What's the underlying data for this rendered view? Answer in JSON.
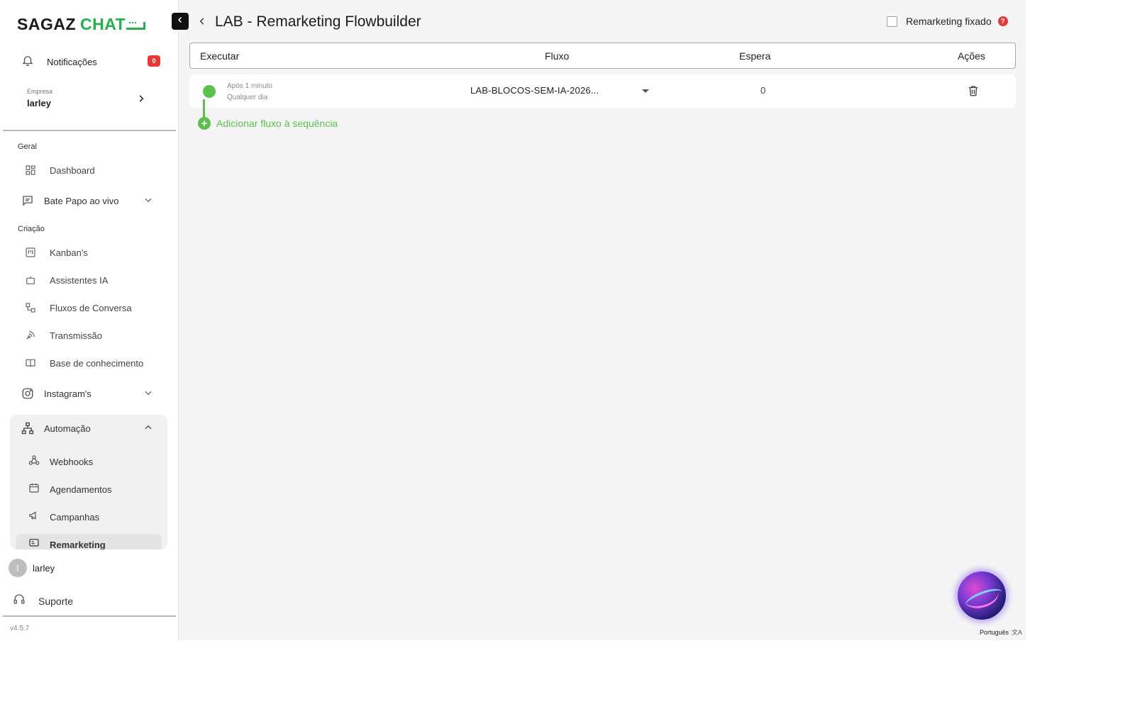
{
  "sidebar": {
    "logo": {
      "part1": "SAGAZ",
      "part2": "CHAT"
    },
    "notifications": {
      "label": "Notificações",
      "count": "0"
    },
    "company": {
      "caption": "Empresa",
      "name": "larley"
    },
    "sections": {
      "geral": "Geral",
      "criacao": "Criação"
    },
    "items": {
      "dashboard": "Dashboard",
      "bate_papo": "Bate Papo ao vivo",
      "kanban": "Kanban's",
      "assistentes": "Assistentes IA",
      "fluxos": "Fluxos de Conversa",
      "transmissao": "Transmissão",
      "base": "Base de conhecimento",
      "instagram": "Instagram's",
      "automacao": "Automação",
      "webhooks": "Webhooks",
      "agendamentos": "Agendamentos",
      "campanhas": "Campanhas",
      "remarketing": "Remarketing"
    },
    "user": {
      "initial": "l",
      "name": "larley"
    },
    "support": "Suporte",
    "version": "v4.5.7"
  },
  "main": {
    "title": "LAB - Remarketing Flowbuilder",
    "fixed_label": "Remarketing fixado",
    "help": "?",
    "columns": {
      "executar": "Executar",
      "fluxo": "Fluxo",
      "espera": "Espera",
      "acoes": "Ações"
    },
    "rows": [
      {
        "when_line1": "Após 1 minuto",
        "when_line2": "Qualquer dia",
        "flow": "LAB-BLOCOS-SEM-IA-2026...",
        "wait": "0"
      }
    ],
    "add_flow": "Adicionar fluxo à sequência"
  },
  "footer": {
    "language": "Português"
  },
  "colors": {
    "accent_green": "#5cbf4e",
    "brand_green": "#22b14c",
    "badge_red": "#e53935"
  }
}
